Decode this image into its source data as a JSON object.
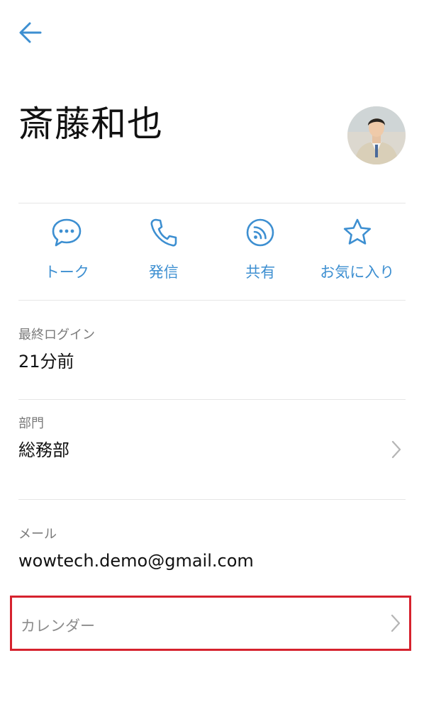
{
  "header": {
    "back_icon": "arrow-left-icon"
  },
  "profile": {
    "name": "斎藤和也",
    "avatar": "user-photo"
  },
  "actions": [
    {
      "label": "トーク",
      "icon": "chat-bubble-icon"
    },
    {
      "label": "発信",
      "icon": "phone-icon"
    },
    {
      "label": "共有",
      "icon": "rss-share-icon"
    },
    {
      "label": "お気に入り",
      "icon": "star-icon"
    }
  ],
  "fields": {
    "last_login": {
      "caption": "最終ログイン",
      "value": "21分前"
    },
    "department": {
      "caption": "部門",
      "value": "総務部"
    },
    "email": {
      "caption": "メール",
      "value": "wowtech.demo@gmail.com"
    },
    "calendar": {
      "label": "カレンダー"
    }
  },
  "colors": {
    "accent": "#3d8fd1",
    "highlight_border": "#d6222e",
    "caption": "#7a7a7a"
  }
}
